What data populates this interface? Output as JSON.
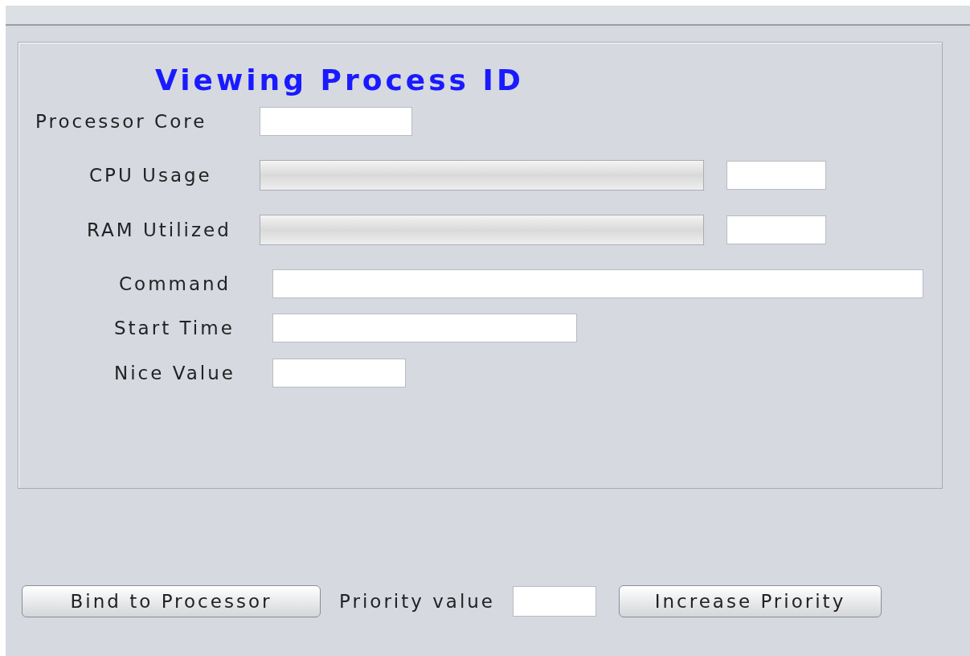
{
  "panel": {
    "title": "Viewing Process ID",
    "fields": [
      {
        "kind": "field",
        "label": "Processor Core"
      },
      {
        "kind": "meter",
        "label": "CPU Usage",
        "level": 0
      },
      {
        "kind": "meter",
        "label": "RAM Utilized",
        "level": 0
      },
      {
        "kind": "field",
        "label": "Command"
      },
      {
        "kind": "field",
        "label": "Start Time"
      },
      {
        "kind": "field",
        "label": "Nice Value"
      }
    ]
  },
  "actions": {
    "bind_button": "Bind to Processor",
    "priority_label": "Priority value",
    "increase_button": "Increase Priority"
  }
}
